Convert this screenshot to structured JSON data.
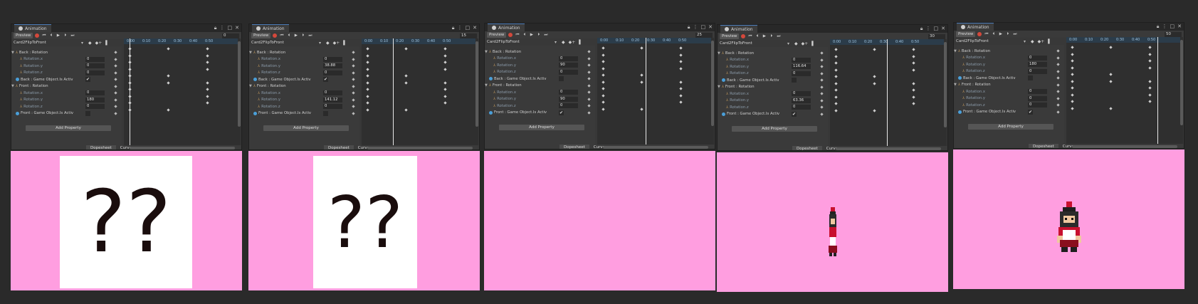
{
  "window": {
    "tab_title": "Animation",
    "preview_label": "Preview",
    "clip_name": "Card2FlipToFront",
    "add_property_label": "Add Property",
    "dopesheet_label": "Dopesheet",
    "curves_label": "Curves",
    "ruler_labels": [
      "0:00",
      "0:10",
      "0:20",
      "0:30",
      "0:40",
      "0:50"
    ]
  },
  "property_labels": {
    "back_group": "Back : Rotation",
    "front_group": "Front : Rotation",
    "rotation_x": "Rotation.x",
    "rotation_y": "Rotation.y",
    "rotation_z": "Rotation.z",
    "back_active": "Back : Game Object.Is Activ",
    "front_active": "Front : Game Object.Is Activ"
  },
  "panels": [
    {
      "frame": "0",
      "back": {
        "x": "0",
        "y": "0",
        "z": "0",
        "active": "✔"
      },
      "front": {
        "x": "0",
        "y": "180",
        "z": "0",
        "active": ""
      },
      "playhead": 0.0,
      "scene": "card",
      "card_text": "??"
    },
    {
      "frame": "15",
      "back": {
        "x": "0",
        "y": "38.88",
        "z": "0",
        "active": "✔"
      },
      "front": {
        "x": "0",
        "y": "141.12",
        "z": "0",
        "active": ""
      },
      "playhead": 0.25,
      "scene": "card",
      "card_text": "??"
    },
    {
      "frame": "25",
      "back": {
        "x": "0",
        "y": "90",
        "z": "0",
        "active": ""
      },
      "front": {
        "x": "0",
        "y": "90",
        "z": "0",
        "active": "✔"
      },
      "playhead": 0.416,
      "scene": "empty",
      "card_text": ""
    },
    {
      "frame": "30",
      "back": {
        "x": "0",
        "y": "116.64",
        "z": "0",
        "active": ""
      },
      "front": {
        "x": "0",
        "y": "63.36",
        "z": "0",
        "active": "✔"
      },
      "playhead": 0.5,
      "scene": "sprite-thin",
      "card_text": ""
    },
    {
      "frame": "50",
      "back": {
        "x": "0",
        "y": "180",
        "z": "0",
        "active": ""
      },
      "front": {
        "x": "0",
        "y": "0",
        "z": "0",
        "active": "✔"
      },
      "playhead": 0.833,
      "scene": "sprite-full",
      "card_text": ""
    }
  ],
  "colors": {
    "scene_bg": "#ff9ee0",
    "editor_bg": "#383838",
    "record": "#d4483b"
  }
}
